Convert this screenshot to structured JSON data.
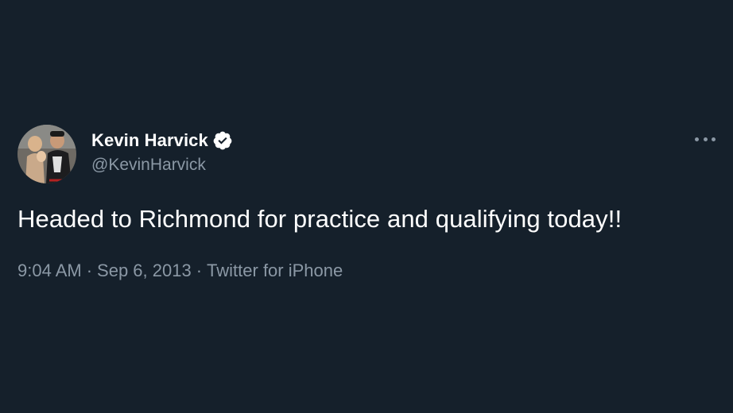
{
  "tweet": {
    "display_name": "Kevin Harvick",
    "handle": "@KevinHarvick",
    "text": "Headed to Richmond for practice and qualifying today!!",
    "time": "9:04 AM",
    "separator": "·",
    "date": "Sep 6, 2013",
    "source": "Twitter for iPhone",
    "verified": true,
    "avatar_icon": "profile-photo",
    "more_icon": "ellipsis-icon"
  },
  "colors": {
    "background": "#15202b",
    "primary_text": "#ffffff",
    "secondary_text": "#8b98a5"
  }
}
